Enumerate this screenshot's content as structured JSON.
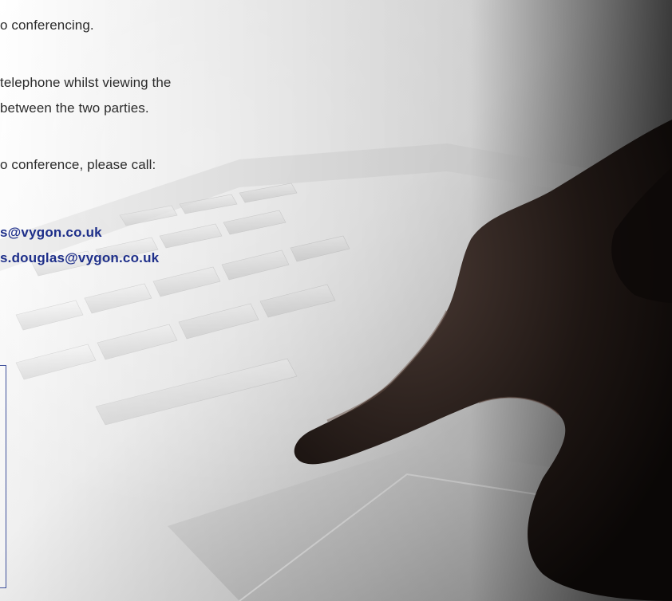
{
  "body_text": {
    "line_1": "o conferencing.",
    "line_2": "telephone whilst viewing the",
    "line_3": "between the two parties.",
    "line_4": "o conference, please call:"
  },
  "contacts": {
    "email_1": "s@vygon.co.uk",
    "email_2": "s.douglas@vygon.co.uk"
  },
  "colors": {
    "email_text": "#1e2f8a",
    "body_text": "#2b2b2b",
    "box_border": "#3d4f9a"
  }
}
